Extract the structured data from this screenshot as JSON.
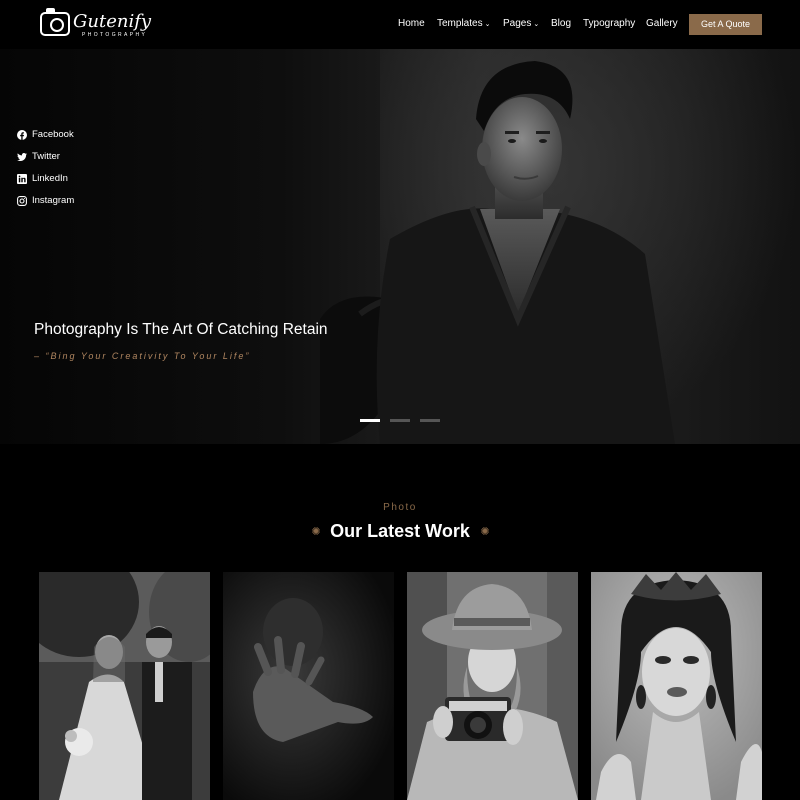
{
  "logo": {
    "name": "Gutenify",
    "tagline": "PHOTOGRAPHY"
  },
  "nav": {
    "home": "Home",
    "templates": "Templates",
    "pages": "Pages",
    "blog": "Blog",
    "typography": "Typography",
    "gallery": "Gallery",
    "caret": "⌄",
    "cta": "Get A Quote"
  },
  "socials": [
    {
      "label": "Facebook",
      "icon": "facebook-icon"
    },
    {
      "label": "Twitter",
      "icon": "twitter-icon"
    },
    {
      "label": "LinkedIn",
      "icon": "linkedin-icon"
    },
    {
      "label": "Instagram",
      "icon": "instagram-icon"
    }
  ],
  "hero": {
    "title": "Photography Is The Art Of Catching Retain",
    "subtitle": "– “Bing Your Creativity To Your Life”",
    "slides": 3,
    "active_slide": 1
  },
  "section": {
    "pretitle": "Photo",
    "title": "Our Latest Work",
    "ornament": "✺"
  },
  "gallery": [
    {
      "subject": "wedding couple"
    },
    {
      "subject": "hand reaching"
    },
    {
      "subject": "woman with hat and camera"
    },
    {
      "subject": "woman with crown"
    }
  ],
  "colors": {
    "accent": "#8a6a4a",
    "subtitle": "#b08660",
    "background": "#000000"
  }
}
